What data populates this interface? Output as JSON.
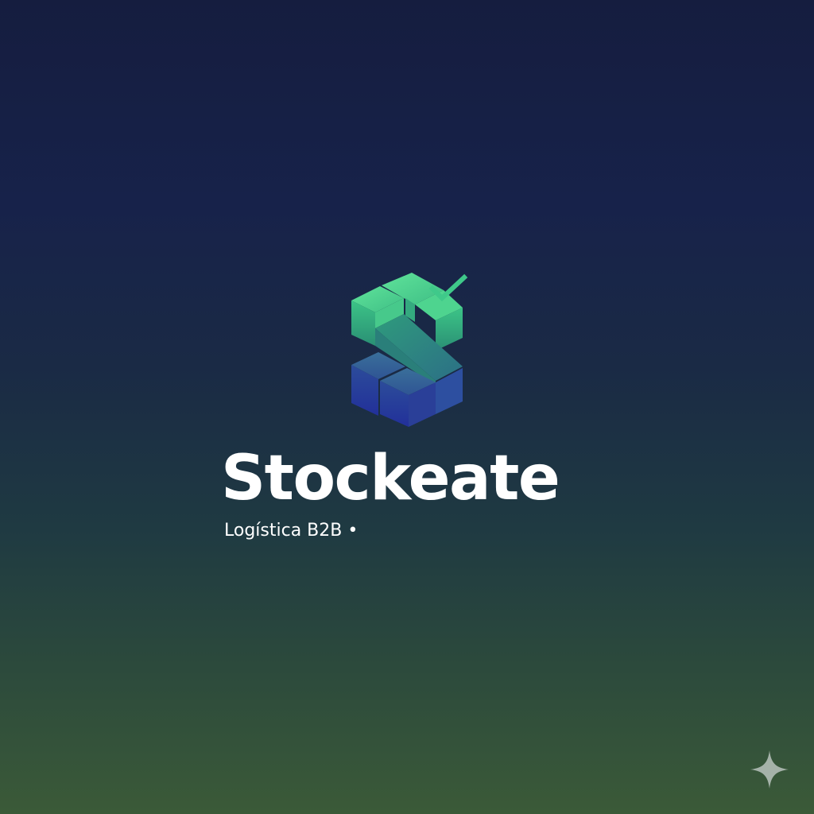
{
  "brand": {
    "name": "Stockeate",
    "tagline": "Logística B2B •"
  },
  "logo": {
    "icon": "stacked-boxes-s-with-checkmark-icon",
    "colors": {
      "green_light": "#4fd18b",
      "green_dark": "#2e9f78",
      "blue_light": "#3a5fa8",
      "blue_dark": "#253a9a",
      "check": "#3fc98a"
    }
  },
  "corner_icon": "sparkle-icon",
  "background": {
    "top": "#151d3f",
    "bottom": "#3b5a38"
  }
}
